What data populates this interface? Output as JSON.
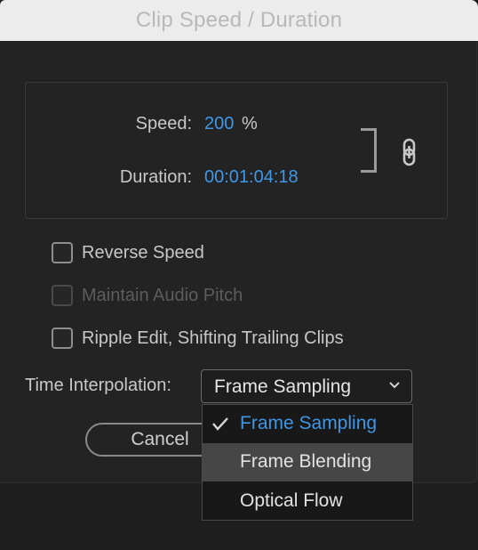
{
  "window": {
    "title": "Clip Speed / Duration"
  },
  "speed_panel": {
    "speed_label": "Speed:",
    "speed_value": "200",
    "speed_unit": "%",
    "duration_label": "Duration:",
    "duration_value": "00:01:04:18",
    "link_icon": "chain-link-icon"
  },
  "options": {
    "reverse_speed": {
      "label": "Reverse Speed",
      "checked": false,
      "enabled": true
    },
    "maintain_audio_pitch": {
      "label": "Maintain Audio Pitch",
      "checked": false,
      "enabled": false
    },
    "ripple_edit": {
      "label": "Ripple Edit, Shifting Trailing Clips",
      "checked": false,
      "enabled": true
    }
  },
  "time_interpolation": {
    "label": "Time Interpolation:",
    "selected": "Frame Sampling",
    "menu_items": [
      {
        "label": "Frame Sampling",
        "selected": true
      },
      {
        "label": "Frame Blending",
        "hovered": true
      },
      {
        "label": "Optical Flow"
      }
    ]
  },
  "buttons": {
    "cancel_label": "Cancel"
  },
  "colors": {
    "accent": "#3f97e6",
    "background": "#232323",
    "titlebar": "#ececec"
  }
}
